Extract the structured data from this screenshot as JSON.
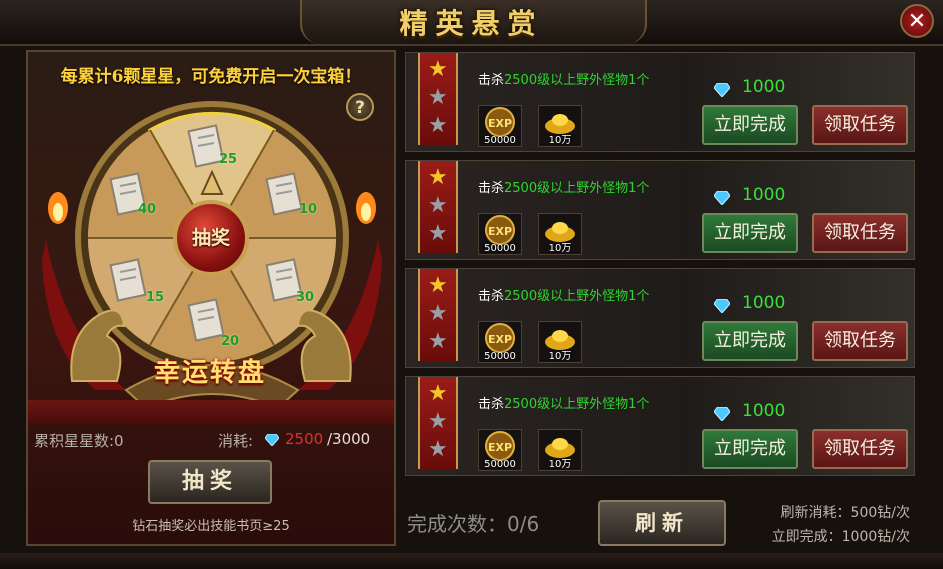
{
  "header": {
    "title": "精英悬赏",
    "close_label": "✕"
  },
  "lottery": {
    "hint": "每累计6颗星星，可免费开启一次宝箱！",
    "help_label": "?",
    "center_button": "抽奖",
    "wheel_title": "幸运转盘",
    "slots": [
      "25",
      "10",
      "30",
      "20",
      "15",
      "40"
    ],
    "accumulated_stars": "累积星星数:0",
    "cost_label": "消耗:",
    "cost_current": "2500",
    "cost_total": "/3000",
    "draw_button": "抽奖",
    "draw_note": "钻石抽奖必出技能书页≥25"
  },
  "tasks": [
    {
      "desc_prefix": "击杀",
      "desc_highlight": "2500级以上野外怪物1个",
      "diamond_reward": "1000",
      "exp_reward": "50000",
      "gold_reward": "10万",
      "complete_label": "立即完成",
      "accept_label": "领取任务",
      "stars": 1
    },
    {
      "desc_prefix": "击杀",
      "desc_highlight": "2500级以上野外怪物1个",
      "diamond_reward": "1000",
      "exp_reward": "50000",
      "gold_reward": "10万",
      "complete_label": "立即完成",
      "accept_label": "领取任务",
      "stars": 1
    },
    {
      "desc_prefix": "击杀",
      "desc_highlight": "2500级以上野外怪物1个",
      "diamond_reward": "1000",
      "exp_reward": "50000",
      "gold_reward": "10万",
      "complete_label": "立即完成",
      "accept_label": "领取任务",
      "stars": 1
    },
    {
      "desc_prefix": "击杀",
      "desc_highlight": "2500级以上野外怪物1个",
      "diamond_reward": "1000",
      "exp_reward": "50000",
      "gold_reward": "10万",
      "complete_label": "立即完成",
      "accept_label": "领取任务",
      "stars": 1
    }
  ],
  "footer": {
    "done_count": "完成次数：0/6",
    "refresh_button": "刷新",
    "refresh_cost": "刷新消耗：500钻/次",
    "complete_cost": "立即完成：1000钻/次"
  },
  "colors": {
    "gold": "#f0cf6a",
    "green": "#2fd52f",
    "red_cost": "#e03030"
  },
  "icons": [
    "close-icon",
    "help-icon",
    "diamond-icon",
    "exp-icon",
    "gold-ingot-icon",
    "star-icon",
    "scroll-icon",
    "dragon-icon"
  ]
}
